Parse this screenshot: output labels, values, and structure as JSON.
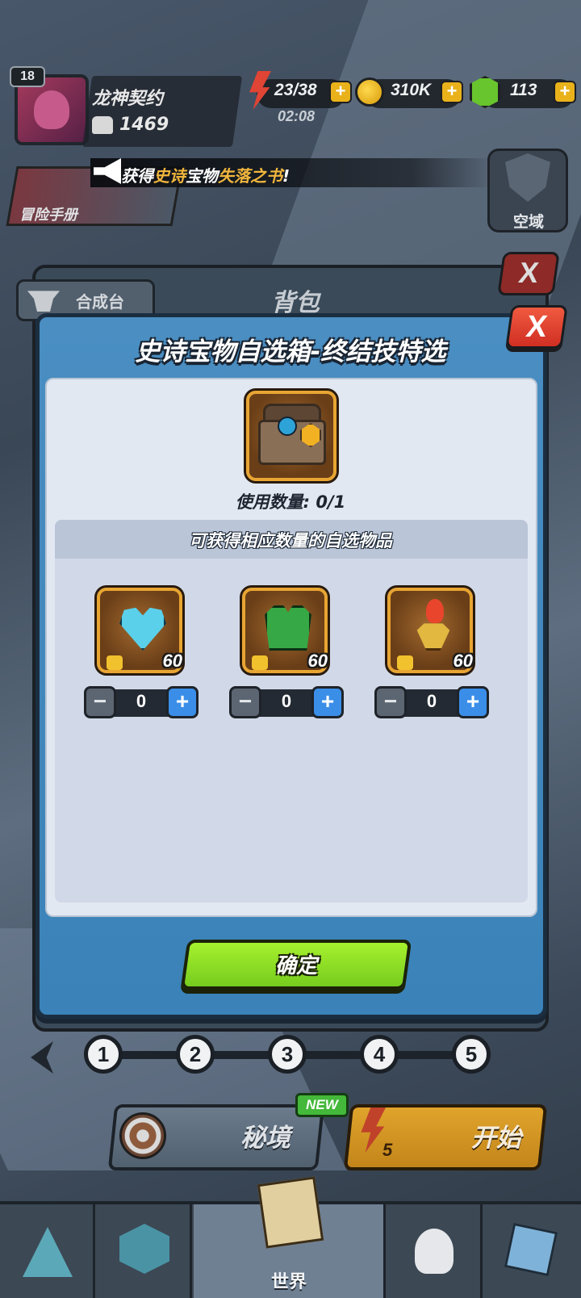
{
  "hud": {
    "level": "18",
    "player_name": "龙神契约",
    "power": "1469",
    "energy": "23/38",
    "energy_timer": "02:08",
    "coins": "310K",
    "gems": "113",
    "plus": "+"
  },
  "ticker": {
    "prefix": "获得",
    "highlight1": "史诗",
    "middle": "宝物",
    "highlight2": "失落之书",
    "suffix": "!"
  },
  "side": {
    "handbook_label": "冒险手册",
    "sky_label": "空域"
  },
  "bag": {
    "forge_label": "合成台",
    "title": "背包",
    "close": "X"
  },
  "dialog": {
    "title": "史诗宝物自选箱-终结技特选",
    "close": "X",
    "chest_icon": "treasure-chest",
    "use_count": "使用数量: 0/1",
    "subtitle": "可获得相应数量的自选物品",
    "items": [
      {
        "icon": "ice-heart-amulet",
        "count": "60",
        "minus": "−",
        "value": "0",
        "plus": "+"
      },
      {
        "icon": "green-vest",
        "count": "60",
        "minus": "−",
        "value": "0",
        "plus": "+"
      },
      {
        "icon": "flame-torch",
        "count": "60",
        "minus": "−",
        "value": "0",
        "plus": "+"
      }
    ],
    "confirm": "确定"
  },
  "stages": [
    "1",
    "2",
    "3",
    "4",
    "5"
  ],
  "actions": {
    "realm_label": "秘境",
    "new_badge": "NEW",
    "start_cost": "5",
    "start_label": "开始"
  },
  "nav": {
    "world_label": "世界"
  },
  "colors": {
    "dialog_blue": "#3a82b8",
    "confirm_green": "#94e22a",
    "close_red": "#e0432f",
    "item_frame_gold": "#e8a532"
  }
}
